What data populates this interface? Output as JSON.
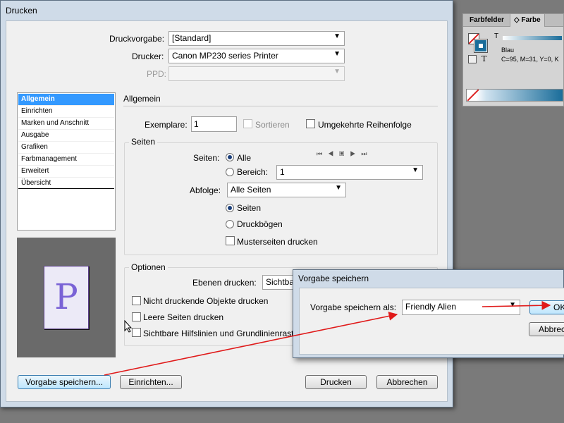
{
  "dialog": {
    "title": "Drucken"
  },
  "form": {
    "preset_label": "Druckvorgabe:",
    "preset_value": "[Standard]",
    "printer_label": "Drucker:",
    "printer_value": "Canon MP230 series Printer",
    "ppd_label": "PPD:",
    "ppd_value": ""
  },
  "categories": [
    "Allgemein",
    "Einrichten",
    "Marken und Anschnitt",
    "Ausgabe",
    "Grafiken",
    "Farbmanagement",
    "Erweitert",
    "Übersicht"
  ],
  "section_title": "Allgemein",
  "copies": {
    "label": "Exemplare:",
    "value": "1",
    "collate_label": "Sortieren",
    "reverse_label": "Umgekehrte Reihenfolge"
  },
  "pages": {
    "group_title": "Seiten",
    "pages_label": "Seiten:",
    "all_label": "Alle",
    "range_label": "Bereich:",
    "range_value": "1",
    "sequence_label": "Abfolge:",
    "sequence_value": "Alle Seiten",
    "pages_option": "Seiten",
    "spreads_option": "Druckbögen",
    "master_label": "Musterseiten drucken"
  },
  "options": {
    "group_title": "Optionen",
    "layers_label": "Ebenen drucken:",
    "layers_value": "Sichtba",
    "nonprinting_label": "Nicht druckende Objekte drucken",
    "blank_pages_label": "Leere Seiten drucken",
    "guides_label": "Sichtbare Hilfslinien und Grundlinienrast"
  },
  "preview": {
    "letter": "P"
  },
  "buttons": {
    "save_preset": "Vorgabe speichern...",
    "setup": "Einrichten...",
    "print": "Drucken",
    "cancel": "Abbrechen"
  },
  "swatch_panel": {
    "tab_swatches": "Farbfelder",
    "tab_color": "Farbe",
    "swatch_name": "Blau",
    "swatch_values": "C=95, M=31, Y=0, K"
  },
  "save_dialog": {
    "title": "Vorgabe speichern",
    "field_label": "Vorgabe speichern als:",
    "field_value": "Friendly Alien",
    "ok": "OK",
    "cancel": "Abbrechen"
  },
  "colors": {
    "selection": "#3399ff",
    "annotation_arrow": "#e01a1a",
    "swatch_blue": "#1a6d9a"
  }
}
